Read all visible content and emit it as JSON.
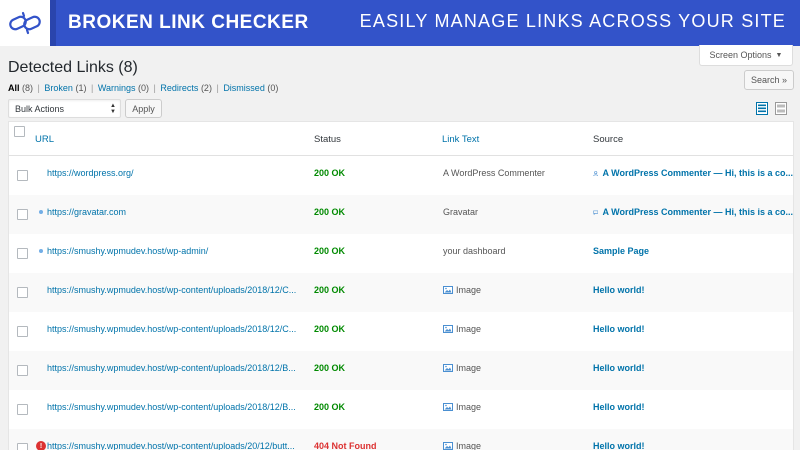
{
  "banner": {
    "title": "BROKEN LINK CHECKER",
    "tagline": "EASILY MANAGE LINKS ACROSS YOUR SITE",
    "logo_icon": "chain-link-icon",
    "bg_color": "#3353c9"
  },
  "screen_options": {
    "label": "Screen Options"
  },
  "page": {
    "title": "Detected Links (8)"
  },
  "filters": [
    {
      "label": "All",
      "count": "(8)",
      "current": true
    },
    {
      "label": "Broken",
      "count": "(1)",
      "current": false
    },
    {
      "label": "Warnings",
      "count": "(0)",
      "current": false
    },
    {
      "label": "Redirects",
      "count": "(2)",
      "current": false
    },
    {
      "label": "Dismissed",
      "count": "(0)",
      "current": false
    }
  ],
  "search": {
    "label": "Search »"
  },
  "bulk": {
    "selected": "Bulk Actions",
    "apply_label": "Apply"
  },
  "table": {
    "headers": {
      "url": "URL",
      "status": "Status",
      "link_text": "Link Text",
      "source": "Source"
    },
    "rows": [
      {
        "url": "https://wordpress.org/",
        "status": "200 OK",
        "status_type": "ok",
        "marker": "none",
        "link_text": "A WordPress Commenter",
        "link_icon": "none",
        "source": "A WordPress Commenter — Hi, this is a co...",
        "source_icon": "user-icon"
      },
      {
        "url": "https://gravatar.com",
        "status": "200 OK",
        "status_type": "ok",
        "marker": "dot",
        "link_text": "Gravatar",
        "link_icon": "none",
        "source": "A WordPress Commenter — Hi, this is a co...",
        "source_icon": "comment-icon"
      },
      {
        "url": "https://smushy.wpmudev.host/wp-admin/",
        "status": "200 OK",
        "status_type": "ok",
        "marker": "dot",
        "link_text": "your dashboard",
        "link_icon": "none",
        "source": "Sample Page",
        "source_icon": "none"
      },
      {
        "url": "https://smushy.wpmudev.host/wp-content/uploads/2018/12/C...",
        "status": "200 OK",
        "status_type": "ok",
        "marker": "none",
        "link_text": "Image",
        "link_icon": "image-icon",
        "source": "Hello world!",
        "source_icon": "none"
      },
      {
        "url": "https://smushy.wpmudev.host/wp-content/uploads/2018/12/C...",
        "status": "200 OK",
        "status_type": "ok",
        "marker": "none",
        "link_text": "Image",
        "link_icon": "image-icon",
        "source": "Hello world!",
        "source_icon": "none"
      },
      {
        "url": "https://smushy.wpmudev.host/wp-content/uploads/2018/12/B...",
        "status": "200 OK",
        "status_type": "ok",
        "marker": "none",
        "link_text": "Image",
        "link_icon": "image-icon",
        "source": "Hello world!",
        "source_icon": "none"
      },
      {
        "url": "https://smushy.wpmudev.host/wp-content/uploads/2018/12/B...",
        "status": "200 OK",
        "status_type": "ok",
        "marker": "none",
        "link_text": "Image",
        "link_icon": "image-icon",
        "source": "Hello world!",
        "source_icon": "none"
      },
      {
        "url": "https://smushy.wpmudev.host/wp-content/uploads/20/12/butt...",
        "status": "404 Not Found",
        "status_type": "bad",
        "marker": "error",
        "link_text": "Image",
        "link_icon": "image-icon",
        "source": "Hello world!",
        "source_icon": "none"
      }
    ]
  },
  "colors": {
    "link": "#0073aa",
    "ok": "#008a00",
    "error": "#dc3232"
  }
}
